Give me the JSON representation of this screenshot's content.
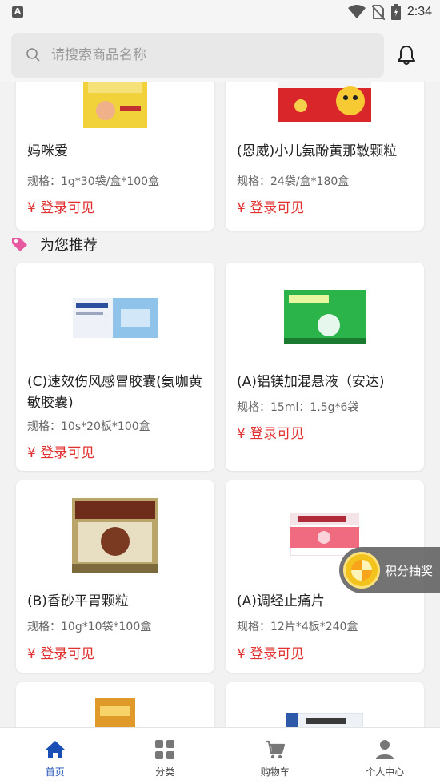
{
  "status": {
    "carrier_badge": "A",
    "time": "2:34"
  },
  "search": {
    "placeholder": "请搜索商品名称"
  },
  "section": {
    "recommend_title": "为您推荐"
  },
  "products_top": [
    {
      "name": "妈咪爱",
      "spec": "规格：1g*30袋/盒*100盒",
      "price": "¥ 登录可见"
    },
    {
      "name": "(恩威)小儿氨酚黄那敏颗粒",
      "spec": "规格：24袋/盒*180盒",
      "price": "¥ 登录可见"
    }
  ],
  "products": [
    {
      "name": "(C)速效伤风感冒胶囊(氨咖黄敏胶囊)",
      "spec": "规格：10s*20板*100盒",
      "price": "¥ 登录可见",
      "box_text": "氨咖黄敏胶囊"
    },
    {
      "name": "(A)铝镁加混悬液（安达)",
      "spec": "规格：15ml：1.5g*6袋",
      "price": "¥ 登录可见",
      "box_text": "铝镁加混悬液"
    },
    {
      "name": "(B)香砂平胃颗粒",
      "spec": "规格：10g*10袋*100盒",
      "price": "¥ 登录可见",
      "box_text": "香砂平胃颗粒"
    },
    {
      "name": "(A)调经止痛片",
      "spec": "规格：12片*4板*240盒",
      "price": "¥ 登录可见",
      "box_text": "调经止痛片"
    }
  ],
  "lottery": {
    "label": "积分抽奖"
  },
  "nav": [
    {
      "label": "首页",
      "icon": "home-icon"
    },
    {
      "label": "分类",
      "icon": "grid-icon"
    },
    {
      "label": "购物车",
      "icon": "cart-icon"
    },
    {
      "label": "个人中心",
      "icon": "person-icon"
    }
  ],
  "colors": {
    "price": "#e03030",
    "nav_active": "#1a4fb5",
    "tag": "#e85aa0"
  }
}
